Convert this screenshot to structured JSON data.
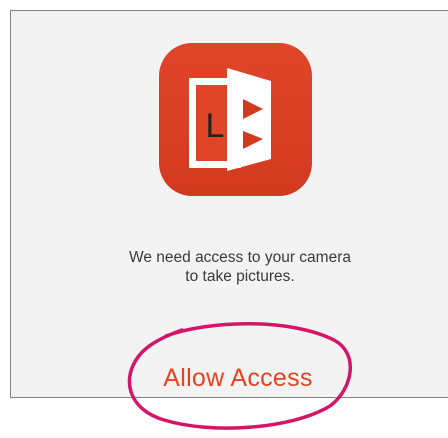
{
  "app": {
    "icon_name": "office-lens-icon",
    "icon_letter": "L",
    "icon_color": "#d94025"
  },
  "permission": {
    "message_line1": "We need access to your camera",
    "message_line2": "to take pictures.",
    "allow_label": "Allow Access",
    "accent_color": "#e8431f"
  },
  "annotation": {
    "circle_color": "#d4156a",
    "circle_target": "allow-access-button"
  }
}
